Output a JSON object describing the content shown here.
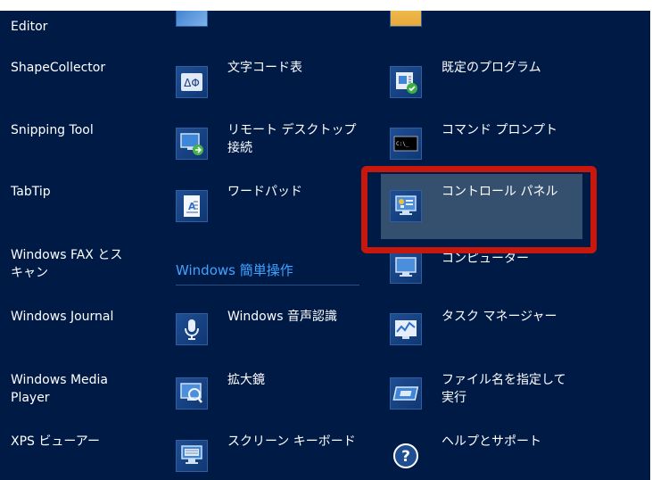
{
  "apps_view": {
    "column1": [
      {
        "label": "Editor"
      },
      {
        "label": "ShapeCollector"
      },
      {
        "label": "Snipping Tool"
      },
      {
        "label": "TabTip"
      },
      {
        "label": "Windows FAX とス\nキャン"
      },
      {
        "label": "Windows Journal"
      },
      {
        "label": "Windows Media\nPlayer"
      },
      {
        "label": "XPS ビューアー"
      }
    ],
    "column2": [
      {
        "label": "文字コード表",
        "icon": "character-map-icon"
      },
      {
        "label": "リモート デスクトップ\n接続",
        "icon": "remote-desktop-icon"
      },
      {
        "label": "ワードパッド",
        "icon": "wordpad-icon"
      },
      {
        "label": "Windows 音声認識",
        "icon": "microphone-icon"
      },
      {
        "label": "拡大鏡",
        "icon": "magnifier-icon"
      },
      {
        "label": "スクリーン キーボード",
        "icon": "on-screen-keyboard-icon"
      }
    ],
    "column3": [
      {
        "label": "既定のプログラム",
        "icon": "default-programs-icon"
      },
      {
        "label": "コマンド プロンプト",
        "icon": "command-prompt-icon"
      },
      {
        "label": "コントロール パネル",
        "icon": "control-panel-icon"
      },
      {
        "label": "コンピューター",
        "icon": "computer-icon"
      },
      {
        "label": "タスク マネージャー",
        "icon": "task-manager-icon"
      },
      {
        "label": "ファイル名を指定して\n実行",
        "icon": "run-icon"
      },
      {
        "label": "ヘルプとサポート",
        "icon": "help-icon"
      }
    ],
    "group_header": "Windows 簡単操作",
    "highlight_color": "#c8180e",
    "background_color": "#001a46"
  }
}
